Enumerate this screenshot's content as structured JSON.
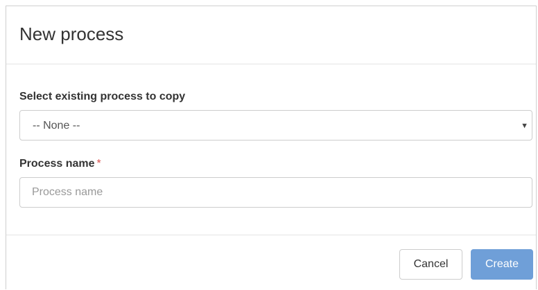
{
  "dialog": {
    "title": "New process"
  },
  "copy_select": {
    "label": "Select existing process to copy",
    "selected": "-- None --",
    "arrow": "▼"
  },
  "process_name": {
    "label": "Process name",
    "required_marker": "*",
    "value": "",
    "placeholder": "Process name"
  },
  "footer": {
    "cancel_label": "Cancel",
    "create_label": "Create"
  },
  "colors": {
    "primary_button": "#6f9fd8",
    "required": "#d9534f"
  }
}
